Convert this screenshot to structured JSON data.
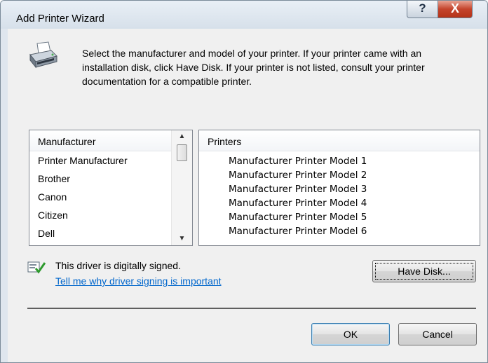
{
  "window": {
    "title": "Add Printer Wizard"
  },
  "titlebar": {
    "help_glyph": "?",
    "close_glyph": "X"
  },
  "description": "Select the manufacturer and model of your printer. If your printer came with an installation disk, click Have Disk. If your printer is not listed, consult your printer documentation for a compatible printer.",
  "manufacturer_list": {
    "header": "Manufacturer",
    "items": [
      "Printer Manufacturer",
      "Brother",
      "Canon",
      "Citizen",
      "Dell"
    ]
  },
  "printer_list": {
    "header": "Printers",
    "items": [
      "Manufacturer Printer Model 1",
      "Manufacturer Printer Model 2",
      "Manufacturer Printer Model 3",
      "Manufacturer Printer Model 4",
      "Manufacturer Printer Model 5",
      "Manufacturer Printer Model 6"
    ]
  },
  "signing": {
    "status": "This driver is digitally signed.",
    "link": "Tell me why driver signing is important"
  },
  "buttons": {
    "have_disk": "Have Disk...",
    "ok": "OK",
    "cancel": "Cancel"
  },
  "icons": {
    "printer": "printer-icon",
    "signed": "signed-driver-icon",
    "scroll_up": "scroll-up-arrow-icon",
    "scroll_down": "scroll-down-arrow-icon"
  }
}
